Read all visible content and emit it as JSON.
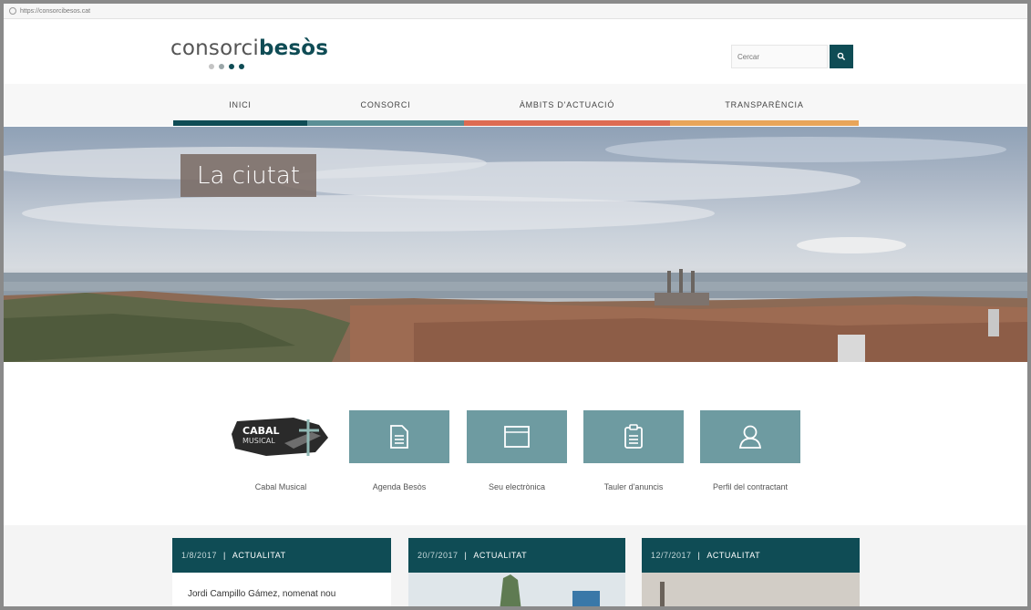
{
  "browser": {
    "url": "https://consorcibesos.cat"
  },
  "logo": {
    "word_light": "consorci",
    "word_bold": "besòs",
    "dot_colors": [
      "#c4c4c4",
      "#9aa6a8",
      "#0f4c55",
      "#0f4c55"
    ]
  },
  "search": {
    "placeholder": "Cercar"
  },
  "nav": [
    {
      "label": "INICI",
      "color": "#0f4c55"
    },
    {
      "label": "CONSORCI",
      "color": "#5b8f96"
    },
    {
      "label": "ÀMBITS D'ACTUACIÓ",
      "color": "#dd6b52"
    },
    {
      "label": "TRANSPARÈNCIA",
      "color": "#e8a55a"
    }
  ],
  "hero": {
    "title": "La ciutat"
  },
  "quick_links": [
    {
      "label": "Cabal Musical",
      "icon": "cabal-musical-logo"
    },
    {
      "label": "Agenda Besòs",
      "icon": "document-icon"
    },
    {
      "label": "Seu electrònica",
      "icon": "browser-window-icon"
    },
    {
      "label": "Tauler d'anuncis",
      "icon": "clipboard-icon"
    },
    {
      "label": "Perfil del contractant",
      "icon": "user-icon"
    }
  ],
  "cabal_logo": {
    "line1": "CABAL",
    "line2": "MUSICAL"
  },
  "news": [
    {
      "date": "1/8/2017",
      "category": "ACTUALITAT",
      "headline": "Jordi Campillo Gámez, nomenat nou"
    },
    {
      "date": "20/7/2017",
      "category": "ACTUALITAT",
      "headline": ""
    },
    {
      "date": "12/7/2017",
      "category": "ACTUALITAT",
      "headline": ""
    }
  ],
  "colors": {
    "brand": "#0f4c55",
    "tile": "#6e9ba1"
  }
}
